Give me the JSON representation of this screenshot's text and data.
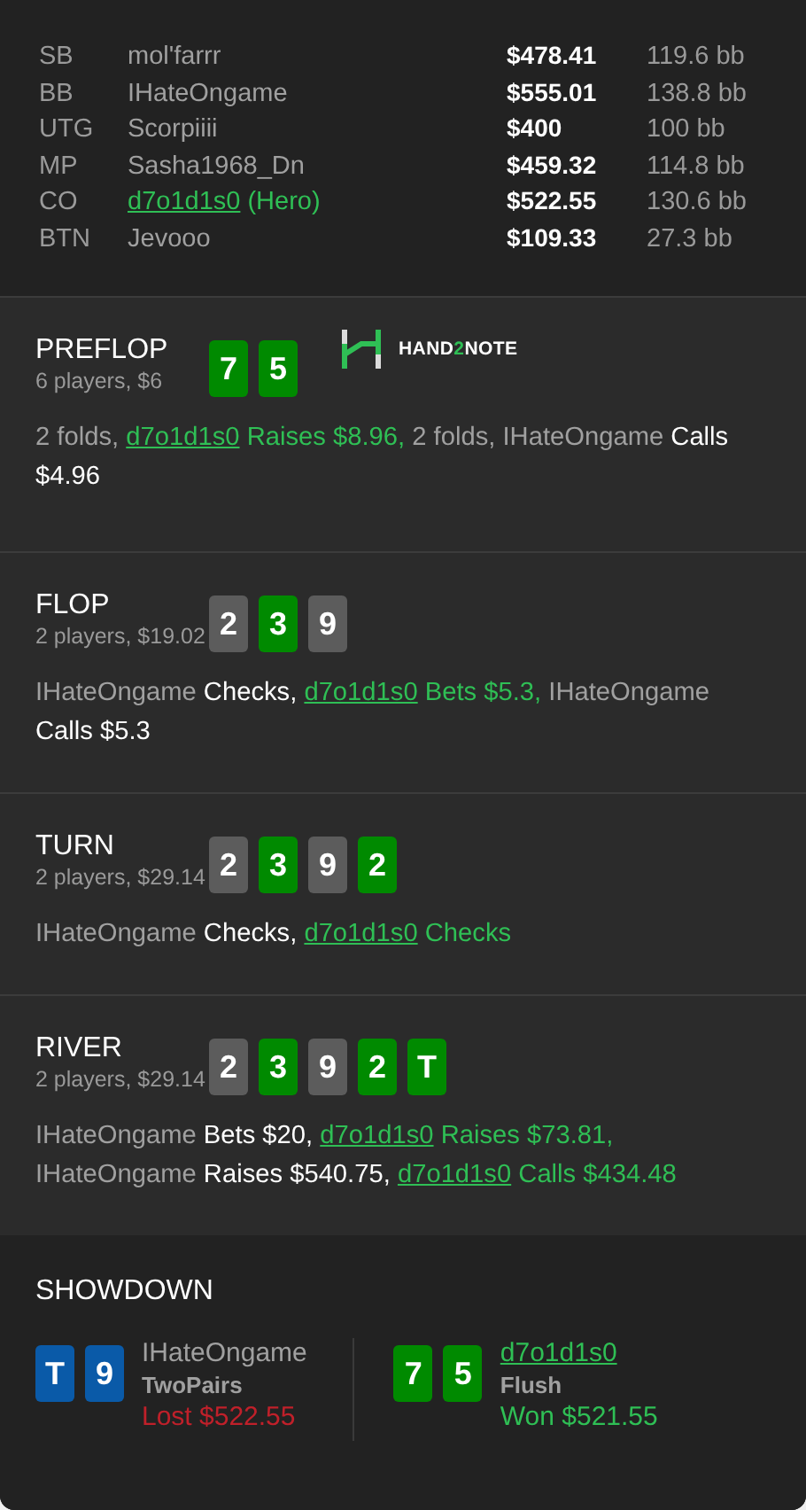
{
  "players": [
    {
      "position": "SB",
      "name": "mol'farrr",
      "hero": false,
      "stack": "$478.41",
      "bb": "119.6 bb"
    },
    {
      "position": "BB",
      "name": "IHateOngame",
      "hero": false,
      "stack": "$555.01",
      "bb": "138.8 bb"
    },
    {
      "position": "UTG",
      "name": "Scorpiiii",
      "hero": false,
      "stack": "$400",
      "bb": "100 bb"
    },
    {
      "position": "MP",
      "name": "Sasha1968_Dn",
      "hero": false,
      "stack": "$459.32",
      "bb": "114.8 bb"
    },
    {
      "position": "CO",
      "name": "d7o1d1s0",
      "hero": true,
      "hero_tag": "(Hero)",
      "stack": "$522.55",
      "bb": "130.6 bb"
    },
    {
      "position": "BTN",
      "name": "Jevooo",
      "hero": false,
      "stack": "$109.33",
      "bb": "27.3 bb"
    }
  ],
  "streets": [
    {
      "title": "PREFLOP",
      "info": "6 players, $6",
      "logo": {
        "text_a": "HAND",
        "text_b": "2",
        "text_c": "NOTE"
      },
      "cards": [
        {
          "rank": "7",
          "color": "#008a00"
        },
        {
          "rank": "5",
          "color": "#008a00"
        }
      ],
      "actions": [
        {
          "kind": "plain",
          "text": "2 folds,"
        },
        {
          "kind": "hero",
          "text": "d7o1d1s0"
        },
        {
          "kind": "hero_action",
          "text": "Raises $8.96,"
        },
        {
          "kind": "plain",
          "text": "2 folds, IHateOngame"
        },
        {
          "kind": "action",
          "text": "Calls $4.96"
        }
      ]
    },
    {
      "title": "FLOP",
      "info": "2 players, $19.02",
      "cards": [
        {
          "rank": "2",
          "color": "#5c5c5c"
        },
        {
          "rank": "3",
          "color": "#008a00"
        },
        {
          "rank": "9",
          "color": "#5c5c5c"
        }
      ],
      "actions": [
        {
          "kind": "plain",
          "text": "IHateOngame"
        },
        {
          "kind": "action",
          "text": "Checks,"
        },
        {
          "kind": "hero",
          "text": "d7o1d1s0"
        },
        {
          "kind": "hero_action",
          "text": "Bets $5.3,"
        },
        {
          "kind": "plain",
          "text": "IHateOngame"
        },
        {
          "kind": "action",
          "text": "Calls $5.3"
        }
      ]
    },
    {
      "title": "TURN",
      "info": "2 players, $29.14",
      "cards": [
        {
          "rank": "2",
          "color": "#5c5c5c"
        },
        {
          "rank": "3",
          "color": "#008a00"
        },
        {
          "rank": "9",
          "color": "#5c5c5c"
        },
        {
          "rank": "2",
          "color": "#008a00"
        }
      ],
      "actions": [
        {
          "kind": "plain",
          "text": "IHateOngame"
        },
        {
          "kind": "action",
          "text": "Checks,"
        },
        {
          "kind": "hero",
          "text": "d7o1d1s0"
        },
        {
          "kind": "hero_action",
          "text": "Checks"
        }
      ]
    },
    {
      "title": "RIVER",
      "info": "2 players, $29.14",
      "cards": [
        {
          "rank": "2",
          "color": "#5c5c5c"
        },
        {
          "rank": "3",
          "color": "#008a00"
        },
        {
          "rank": "9",
          "color": "#5c5c5c"
        },
        {
          "rank": "2",
          "color": "#008a00"
        },
        {
          "rank": "T",
          "color": "#008a00"
        }
      ],
      "actions": [
        {
          "kind": "plain",
          "text": "IHateOngame"
        },
        {
          "kind": "action",
          "text": "Bets $20,"
        },
        {
          "kind": "hero",
          "text": "d7o1d1s0"
        },
        {
          "kind": "hero_action",
          "text": "Raises $73.81,"
        },
        {
          "kind": "plain",
          "text": "IHateOngame"
        },
        {
          "kind": "action",
          "text": "Raises $540.75,"
        },
        {
          "kind": "hero",
          "text": "d7o1d1s0"
        },
        {
          "kind": "hero_action",
          "text": "Calls $434.48"
        }
      ]
    }
  ],
  "showdown": {
    "title": "SHOWDOWN",
    "hands": [
      {
        "name": "IHateOngame",
        "hero": false,
        "hand": "TwoPairs",
        "result": "Lost $522.55",
        "won": false,
        "cards": [
          {
            "rank": "T",
            "color": "#0a5aa8"
          },
          {
            "rank": "9",
            "color": "#0a5aa8"
          }
        ]
      },
      {
        "name": "d7o1d1s0",
        "hero": true,
        "hand": "Flush",
        "result": "Won $521.55",
        "won": true,
        "cards": [
          {
            "rank": "7",
            "color": "#008a00"
          },
          {
            "rank": "5",
            "color": "#008a00"
          }
        ]
      }
    ]
  }
}
